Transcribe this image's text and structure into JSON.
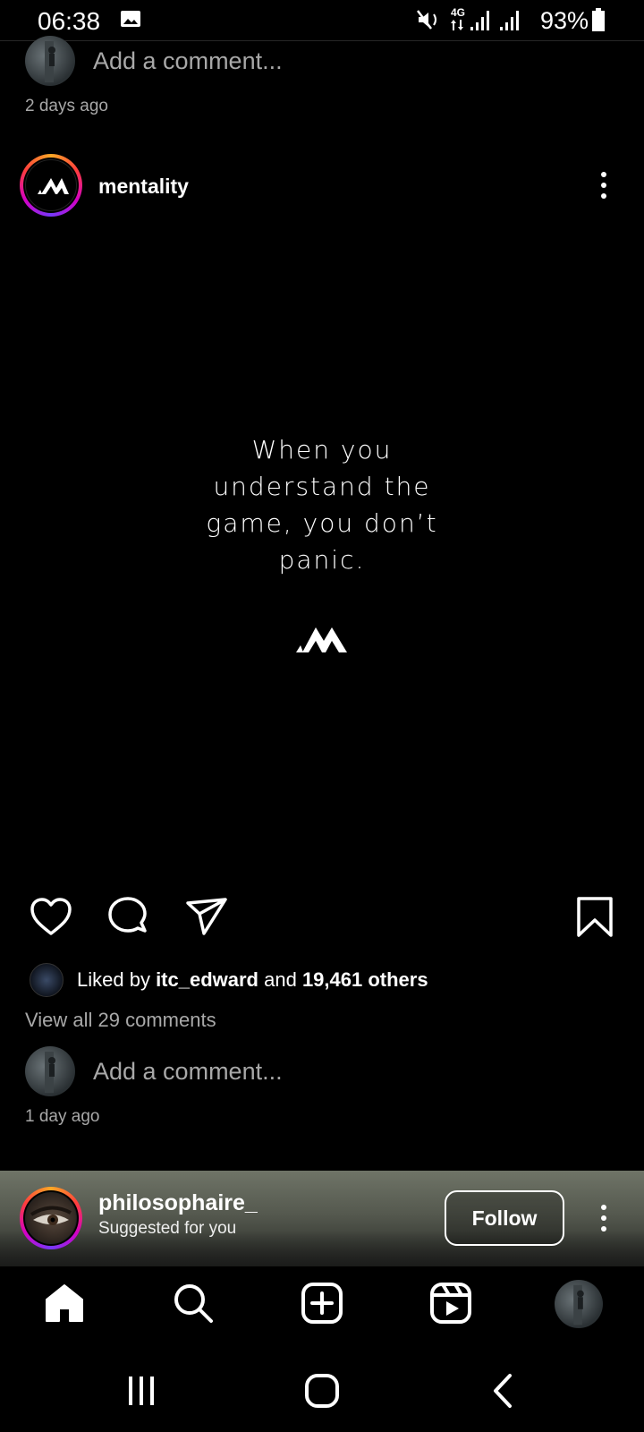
{
  "status_bar": {
    "time": "06:38",
    "network": "4G",
    "battery_percent": "93%",
    "icons": [
      "gallery-icon",
      "mute-vibrate-icon",
      "signal-icon",
      "signal-icon",
      "battery-icon"
    ]
  },
  "previous_post": {
    "comment_placeholder": "Add a comment...",
    "time_ago": "2 days ago"
  },
  "post": {
    "username": "mentality",
    "quote": [
      "When you",
      "understand the",
      "game, you don’t",
      "panic."
    ],
    "liked_prefix": "Liked by ",
    "liked_user": "itc_edward",
    "liked_and": " and ",
    "liked_others": "19,461 others",
    "view_all_comments": "View all 29 comments",
    "comment_placeholder": "Add a comment...",
    "time_ago": "1 day ago"
  },
  "suggested": {
    "username": "philosophaire_",
    "subtitle": "Suggested for you",
    "follow_label": "Follow"
  },
  "colors": {
    "background": "#000000",
    "secondary_text": "#a8a8a8",
    "story_ring": [
      "#f9a825",
      "#ff3d3d",
      "#d300c5",
      "#7638fa"
    ]
  },
  "bottom_nav": [
    "home-icon",
    "search-icon",
    "create-icon",
    "reels-icon",
    "profile-icon"
  ],
  "system_nav": [
    "recents-icon",
    "home-button-icon",
    "back-icon"
  ]
}
